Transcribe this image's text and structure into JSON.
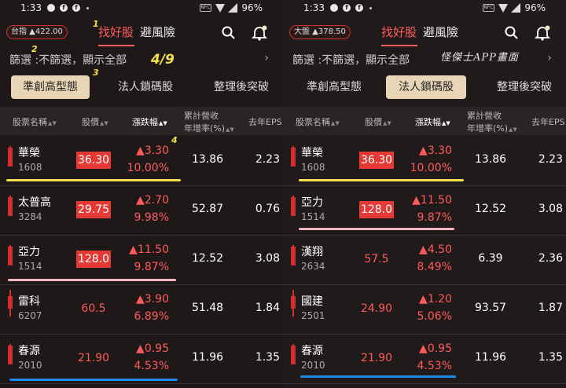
{
  "colors": {
    "accent": "#ff5c5c",
    "up": "#ff5b5b",
    "highlight": "#e53935",
    "active_subtab_bg": "#e8d5b6",
    "yellow": "#f4e04d",
    "pink": "#f4b6c2",
    "blue": "#1e88e5"
  },
  "left": {
    "status": {
      "time": "1:33",
      "battery": "96%"
    },
    "index_badge": "台指 ▲422.00",
    "nav": {
      "tab1": "找好股",
      "tab2": "避風險"
    },
    "filter": "篩選 :不篩選，顯示全部",
    "subtabs": [
      "準創高型態",
      "法人鎖碼股",
      "整理後突破"
    ],
    "headers": {
      "name": "股票名稱",
      "price": "股價",
      "change": "漲跌幅",
      "rev1": "累計營收",
      "rev2": "年增率(%)",
      "eps": "去年EPS"
    },
    "rows": [
      {
        "name": "華榮",
        "code": "1608",
        "price": "36.30",
        "change": "▲3.30",
        "pct": "10.00%",
        "rev": "13.86",
        "eps": "2.23"
      },
      {
        "name": "太普高",
        "code": "3284",
        "price": "29.75",
        "change": "▲2.70",
        "pct": "9.98%",
        "rev": "52.87",
        "eps": "0.76"
      },
      {
        "name": "亞力",
        "code": "1514",
        "price": "128.0",
        "change": "▲11.50",
        "pct": "9.87%",
        "rev": "12.52",
        "eps": "3.08"
      },
      {
        "name": "雷科",
        "code": "6207",
        "price": "60.5",
        "change": "▲3.90",
        "pct": "6.89%",
        "rev": "51.48",
        "eps": "1.84"
      },
      {
        "name": "春源",
        "code": "2010",
        "price": "21.90",
        "change": "▲0.95",
        "pct": "4.53%",
        "rev": "11.96",
        "eps": "1.35"
      }
    ],
    "annotations": {
      "a1": "1",
      "a2": "2",
      "a3": "3",
      "a4": "4",
      "count": "4/9"
    }
  },
  "right": {
    "status": {
      "time": "1:33",
      "battery": "96%"
    },
    "index_badge": "大盤 ▲378.50",
    "nav": {
      "tab1": "找好股",
      "tab2": "避風險"
    },
    "filter": "篩選 :不篩選，顯示全部",
    "subtabs": [
      "準創高型態",
      "法人鎖碼股",
      "整理後突破"
    ],
    "headers": {
      "name": "股票名稱",
      "price": "股價",
      "change": "漲跌幅",
      "rev1": "累計營收",
      "rev2": "年增率(%)",
      "eps": "去年EPS"
    },
    "rows": [
      {
        "name": "華榮",
        "code": "1608",
        "price": "36.30",
        "change": "▲3.30",
        "pct": "10.00%",
        "rev": "13.86",
        "eps": "2.23"
      },
      {
        "name": "亞力",
        "code": "1514",
        "price": "128.0",
        "change": "▲11.50",
        "pct": "9.87%",
        "rev": "12.52",
        "eps": "3.08"
      },
      {
        "name": "漢翔",
        "code": "2634",
        "price": "57.5",
        "change": "▲4.50",
        "pct": "8.49%",
        "rev": "6.39",
        "eps": "2.36"
      },
      {
        "name": "國建",
        "code": "2501",
        "price": "24.90",
        "change": "▲1.20",
        "pct": "5.06%",
        "rev": "93.57",
        "eps": "1.87"
      },
      {
        "name": "春源",
        "code": "2010",
        "price": "21.90",
        "change": "▲0.95",
        "pct": "4.53%",
        "rev": "11.96",
        "eps": "1.35"
      }
    ],
    "handwriting": "怪傑士APP畫面"
  }
}
